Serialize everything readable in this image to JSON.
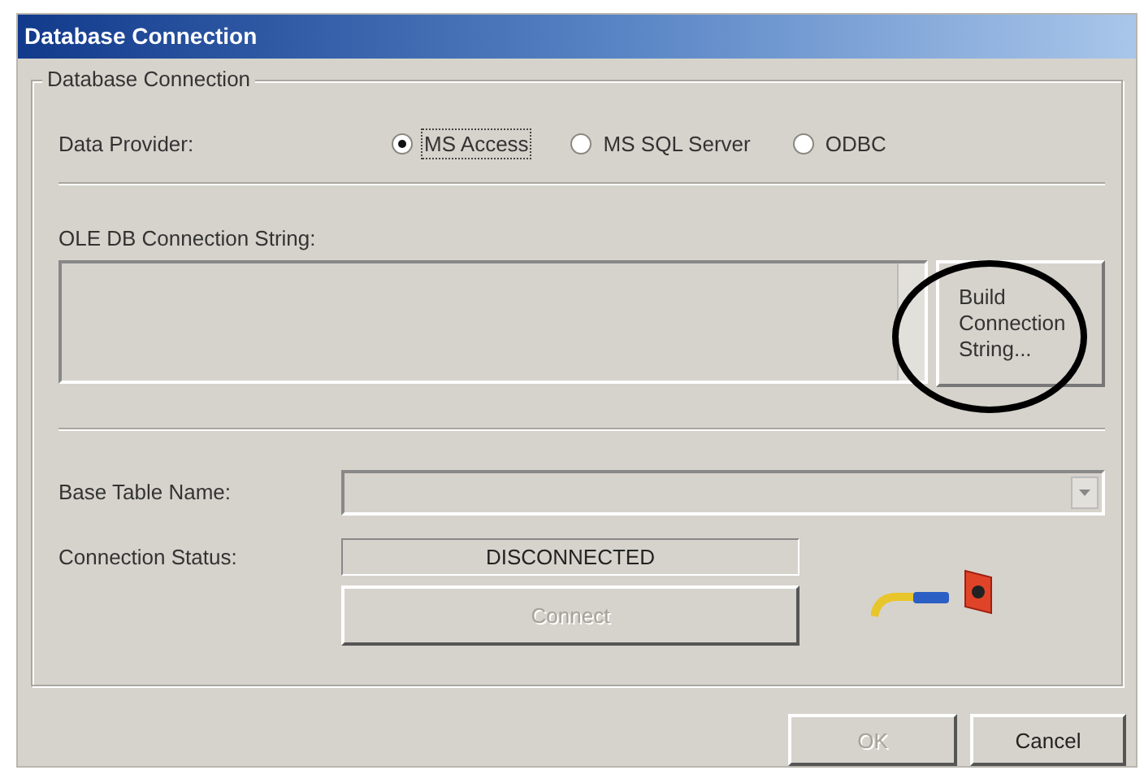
{
  "window": {
    "title": "Database Connection"
  },
  "group": {
    "title": "Database Connection"
  },
  "data_provider": {
    "label": "Data Provider:",
    "options": [
      {
        "label": "MS Access",
        "selected": true
      },
      {
        "label": "MS SQL Server",
        "selected": false
      },
      {
        "label": "ODBC",
        "selected": false
      }
    ]
  },
  "connection_string": {
    "label": "OLE DB Connection String:",
    "build_button": "Build Connection String..."
  },
  "base_table": {
    "label": "Base Table Name:"
  },
  "status": {
    "label": "Connection Status:",
    "value": "DISCONNECTED"
  },
  "connect_button": {
    "label": "Connect",
    "disabled": true
  },
  "buttons": [
    {
      "label": "OK",
      "disabled": true
    },
    {
      "label": "Cancel",
      "disabled": false
    }
  ]
}
